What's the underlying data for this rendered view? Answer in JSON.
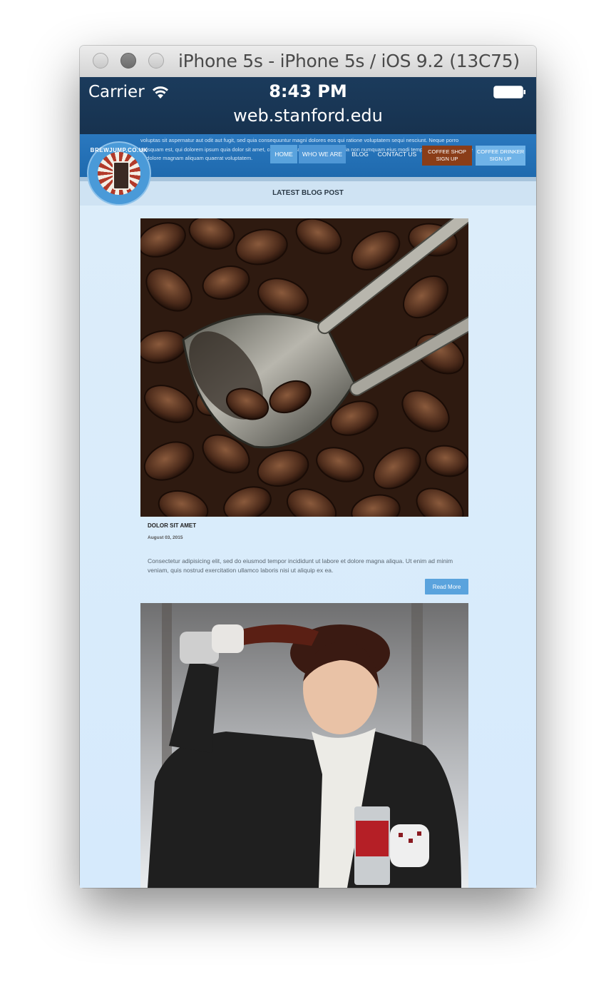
{
  "window": {
    "title": "iPhone 5s - iPhone 5s / iOS 9.2 (13C75)"
  },
  "status_bar": {
    "carrier": "Carrier",
    "time": "8:43 PM",
    "url": "web.stanford.edu"
  },
  "header": {
    "lorem_text": "voluptas sit aspernatur aut odit aut fugit, sed quia consequuntur magni dolores eos qui ratione voluptatem sequi nesciunt. Neque porro quisquam est, qui dolorem ipsum quia dolor sit amet, consectetur, adipisci velit, sed quia non numquam eius modi tempora incidunt ut labore et dolore magnam aliquam quaerat voluptatem.",
    "logo_text": "BREWJUMP.CO.UK",
    "nav": {
      "home": "HOME",
      "who_we_are": "WHO WE ARE",
      "blog": "BLOG",
      "contact_us": "CONTACT US",
      "coffee_shop_signup": "COFFEE SHOP SIGN UP",
      "coffee_drinker_signup": "COFFEE DRINKER SIGN UP"
    }
  },
  "section": {
    "title": "LATEST BLOG POST"
  },
  "posts": [
    {
      "title": "DOLOR SIT AMET",
      "date": "August 03, 2015",
      "excerpt": "Consectetur adipisicing elit, sed do eiusmod tempor incididunt ut labore et dolore magna aliqua. Ut enim ad minim veniam, quis nostrud exercitation ullamco laboris nisi ut aliquip ex ea.",
      "read_more": "Read More"
    }
  ]
}
